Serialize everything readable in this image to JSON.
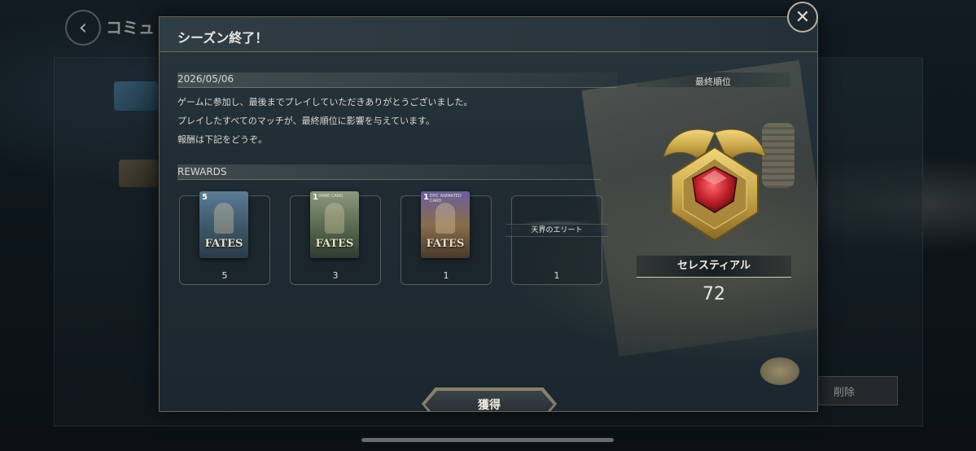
{
  "background": {
    "header_title": "コミュ",
    "delete_label": "削除"
  },
  "modal": {
    "title": "シーズン終了！",
    "date": "2026/05/06",
    "message_lines": [
      "ゲームに参加し、最後までプレイしていただきありがとうございました。",
      "プレイしたすべてのマッチが、最終順位に影響を与えています。",
      "報酬は下記をどうぞ。"
    ],
    "rewards_label": "REWARDS",
    "rewards": [
      {
        "icon": "card-pack-icon",
        "pack_count": "5",
        "pack_tag": "",
        "pack_name": "FATES",
        "quantity": "5"
      },
      {
        "icon": "rare-card-pack-icon",
        "pack_count": "1",
        "pack_tag": "RARE CARD",
        "pack_name": "FATES",
        "quantity": "3"
      },
      {
        "icon": "epic-card-pack-icon",
        "pack_count": "1",
        "pack_tag": "EPIC ANIMATED CARD",
        "pack_name": "FATES",
        "quantity": "1"
      },
      {
        "icon": "title-icon",
        "title_text": "天界のエリート",
        "quantity": "1"
      }
    ],
    "final_rank_label": "最終順位",
    "rank_badge_icon": "celestial-rank-badge-icon",
    "rank_name": "セレスティアル",
    "rank_score": "72",
    "claim_button": "獲得",
    "close_icon": "close-icon"
  },
  "colors": {
    "gold": "#c9a84a",
    "ruby": "#c0202a",
    "frame": "#6d6350"
  }
}
